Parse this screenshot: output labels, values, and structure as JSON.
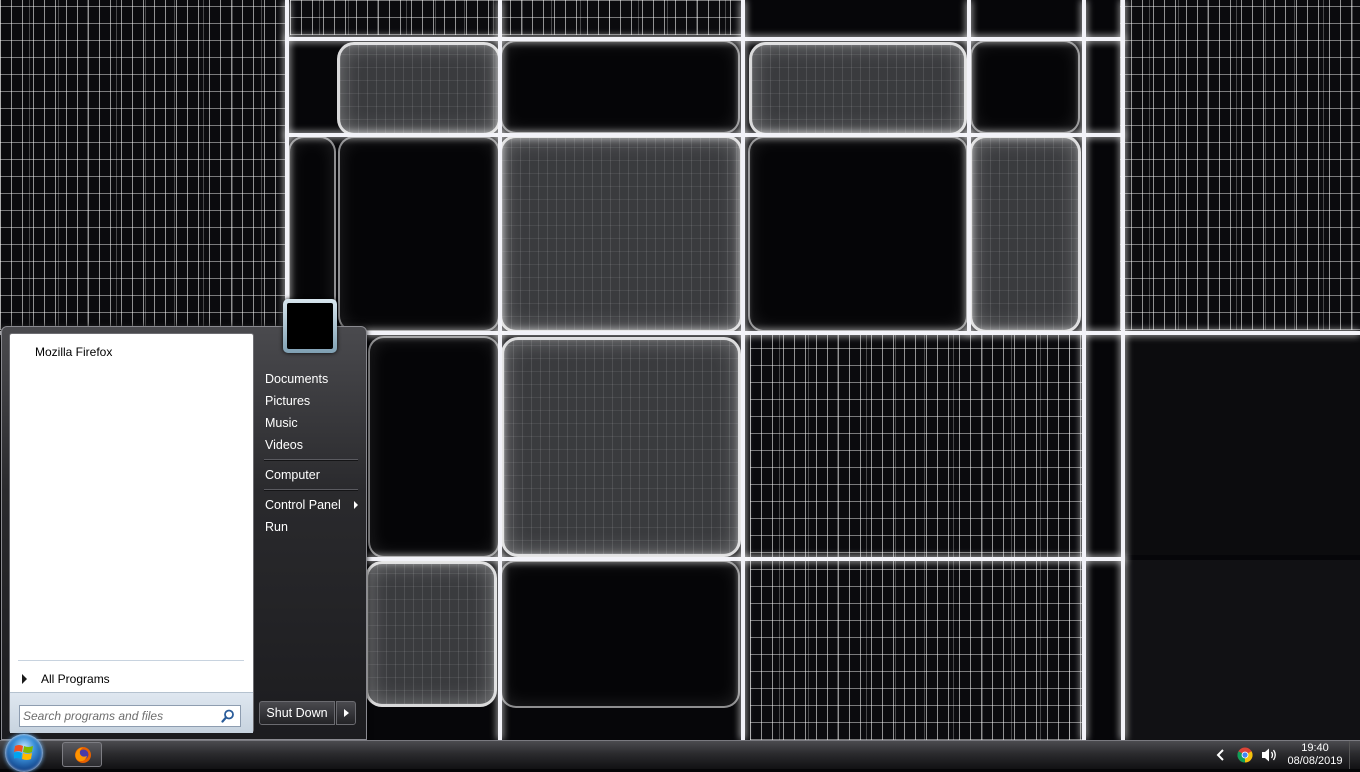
{
  "start_menu": {
    "pinned": [
      {
        "label": "Mozilla Firefox"
      }
    ],
    "all_programs_label": "All Programs",
    "search": {
      "placeholder": "Search programs and files",
      "value": ""
    },
    "right_links": [
      {
        "label": "Documents"
      },
      {
        "label": "Pictures"
      },
      {
        "label": "Music"
      },
      {
        "label": "Videos"
      },
      {
        "label": "Computer"
      },
      {
        "label": "Control Panel",
        "has_submenu": true
      },
      {
        "label": "Run"
      }
    ],
    "shutdown_label": "Shut Down"
  },
  "taskbar": {
    "apps": [
      {
        "name": "firefox-icon"
      }
    ],
    "tray": [
      "chevron-left-icon",
      "chrome-icon",
      "volume-icon"
    ],
    "clock": {
      "time": "19:40",
      "date": "08/08/2019"
    }
  },
  "colors": {
    "taskbar": "#2b2b2e",
    "start_menu_left": "#ffffff",
    "start_menu_right": "#2a2a2d",
    "accent": "#3a8fd8"
  }
}
